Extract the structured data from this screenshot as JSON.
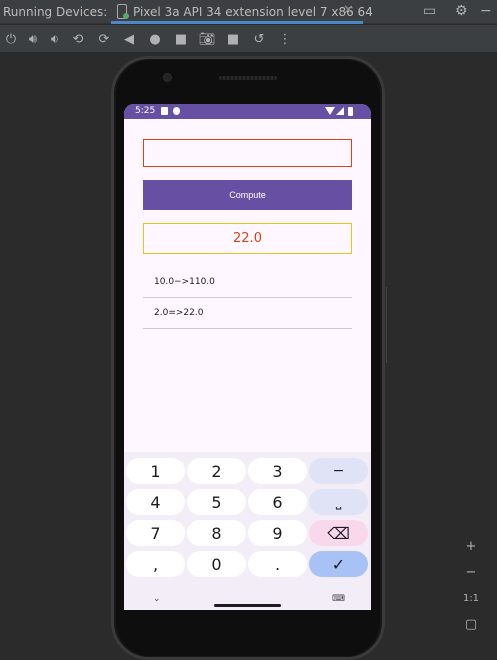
{
  "ide": {
    "panel_title": "Running Devices:",
    "device_tab_label": "Pixel 3a API 34 extension level 7 x86 64",
    "tab_close": "✕",
    "toolbar_icons": [
      "power-icon",
      "volume-up-icon",
      "volume-down-icon",
      "rotate-left-icon",
      "rotate-right-icon",
      "back-icon",
      "home-icon",
      "overview-icon",
      "screenshot-icon",
      "screen-record-icon",
      "snapshot-icon",
      "more-icon"
    ],
    "zoom_in": "+",
    "zoom_out": "−",
    "zoom_actual": "1:1"
  },
  "device": {
    "status_time": "5:25"
  },
  "app": {
    "input_value": "",
    "compute_label": "Compute",
    "result_text": "22.0",
    "history": [
      "10.0−>110.0",
      "2.0=>22.0"
    ]
  },
  "keyboard": {
    "keys": [
      [
        "1",
        "2",
        "3",
        "−"
      ],
      [
        "4",
        "5",
        "6",
        "⎵"
      ],
      [
        "7",
        "8",
        "9",
        "⌫"
      ],
      [
        ",",
        "0",
        ".",
        "✓"
      ]
    ],
    "hide_glyph": "⌄",
    "switch_glyph": "⌨"
  },
  "colors": {
    "primary": "#6750a4",
    "error": "#d84315",
    "result_border": "#e8c51a",
    "ide_accent": "#4a88c7"
  }
}
